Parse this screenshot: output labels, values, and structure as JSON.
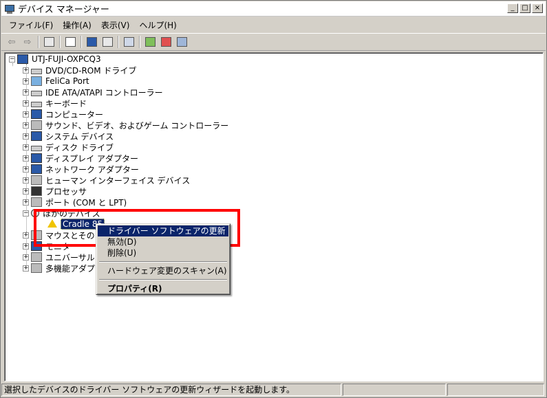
{
  "window": {
    "title": "デバイス マネージャー"
  },
  "window_buttons": [
    "_",
    "□",
    "×"
  ],
  "menu": [
    "ファイル(F)",
    "操作(A)",
    "表示(V)",
    "ヘルプ(H)"
  ],
  "tree": {
    "root": "UTJ-FUJI-OXPCQ3",
    "categories": [
      "DVD/CD-ROM ドライブ",
      "FeliCa Port",
      "IDE ATA/ATAPI コントローラー",
      "キーボード",
      "コンピューター",
      "サウンド、ビデオ、およびゲーム コントローラー",
      "システム デバイス",
      "ディスク ドライブ",
      "ディスプレイ アダプター",
      "ネットワーク アダプター",
      "ヒューマン インターフェイス デバイス",
      "プロセッサ",
      "ポート (COM と LPT)",
      "ほかのデバイス"
    ],
    "child_device": "Cradle 85",
    "after_categories": [
      "マウスとそのほか",
      "モニター",
      "ユニバーサル シ",
      "多機能アダプタ"
    ]
  },
  "context_menu": {
    "update": "ドライバー ソフトウェアの更新(P)...",
    "disable": "無効(D)",
    "uninstall": "削除(U)",
    "scan": "ハードウェア変更のスキャン(A)",
    "properties": "プロパティ(R)"
  },
  "status": {
    "text": "選択したデバイスのドライバー ソフトウェアの更新ウィザードを起動します。"
  },
  "colors": {
    "selection": "#0a246a",
    "highlight_box": "#ff0000",
    "warning_icon": "#f0c400"
  }
}
